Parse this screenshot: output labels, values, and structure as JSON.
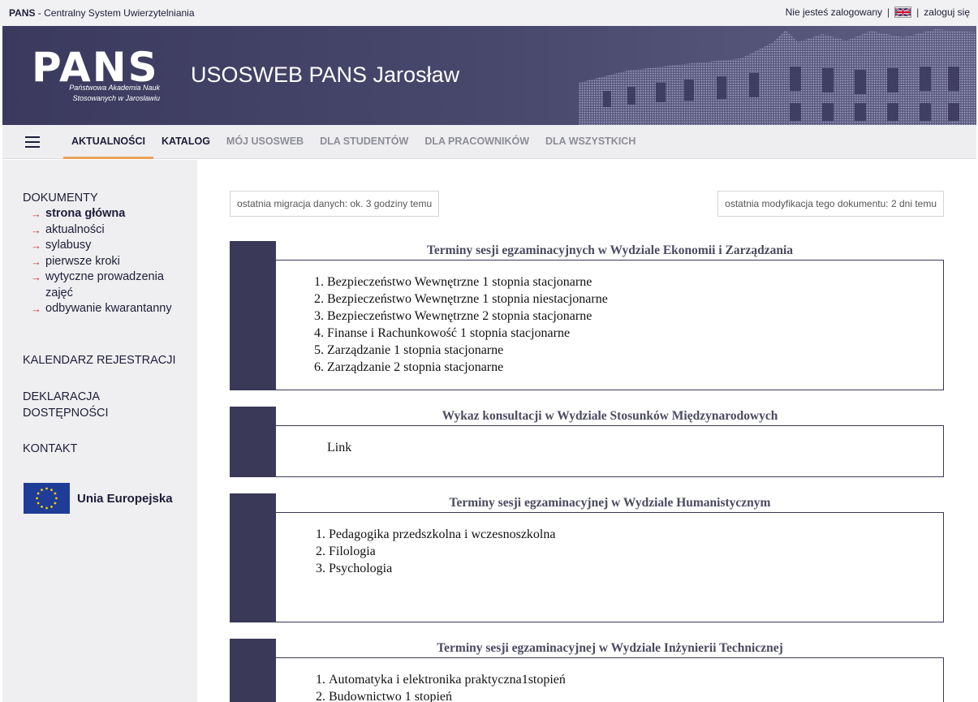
{
  "topbar": {
    "brand_strong": "PANS",
    "brand_rest": " - Centralny System Uwierzytelniania",
    "not_logged": "Nie jesteś zalogowany",
    "sep1": "|",
    "sep2": "|",
    "login": "zaloguj się"
  },
  "banner": {
    "logo": "PANS",
    "logo_line1": "Państwowa Akademia Nauk",
    "logo_line2": "Stosowanych w Jarosławiu",
    "title": "USOSWEB PANS Jarosław"
  },
  "nav": {
    "tabs": [
      {
        "label": "AKTUALNOŚCI"
      },
      {
        "label": "KATALOG"
      },
      {
        "label": "MÓJ USOSWEB"
      },
      {
        "label": "DLA STUDENTÓW"
      },
      {
        "label": "DLA PRACOWNIKÓW"
      },
      {
        "label": "DLA WSZYSTKICH"
      }
    ]
  },
  "sidebar": {
    "section_docs": "DOKUMENTY",
    "items": [
      {
        "label": "strona główna"
      },
      {
        "label": "aktualności"
      },
      {
        "label": "sylabusy"
      },
      {
        "label": "pierwsze kroki"
      },
      {
        "label": "wytyczne prowadzenia zajęć"
      },
      {
        "label": "odbywanie kwarantanny"
      }
    ],
    "section_calendar": "KALENDARZ REJESTRACJI",
    "section_access_1": "DEKLARACJA",
    "section_access_2": "DOSTĘPNOŚCI",
    "section_contact": "KONTAKT",
    "eu_label": "Unia Europejska"
  },
  "main": {
    "migration": "ostatnia migracja danych: ok. 3 godziny temu",
    "modified": "ostatnia modyfikacja tego dokumentu: 2 dni temu",
    "cards": [
      {
        "title": "Terminy sesji egzaminacyjnych w Wydziale Ekonomii i Zarządzania",
        "items": [
          "Bezpieczeństwo Wewnętrzne 1 stopnia stacjonarne",
          "Bezpieczeństwo Wewnętrzne 1 stopnia niestacjonarne",
          "Bezpieczeństwo Wewnętrzne 2 stopnia stacjonarne",
          "Finanse i Rachunkowość 1 stopnia stacjonarne",
          "Zarządzanie 1 stopnia stacjonarne",
          "Zarządzanie 2 stopnia stacjonarne"
        ]
      },
      {
        "title": "Wykaz konsultacji w Wydziale Stosunków Międzynarodowych",
        "link": "Link"
      },
      {
        "title": "Terminy sesji egzaminacyjnej w Wydziale Humanistycznym",
        "items": [
          "Pedagogika przedszkolna i wczesnoszkolna",
          "Filologia",
          "Psychologia"
        ]
      },
      {
        "title": "Terminy sesji egzaminacyjnej w Wydziale Inżynierii Technicznej",
        "items": [
          "Automatyka i elektronika praktyczna1stopień",
          "Budownictwo 1 stopień"
        ]
      }
    ]
  }
}
